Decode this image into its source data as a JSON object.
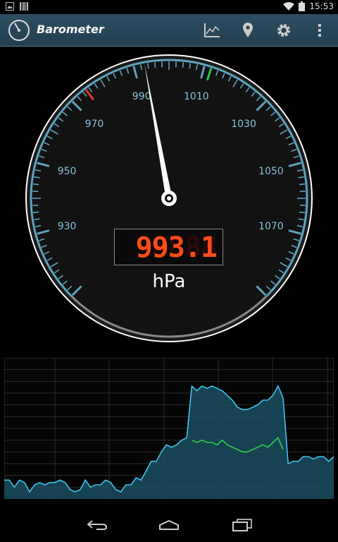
{
  "status_bar": {
    "time": "15:53"
  },
  "action_bar": {
    "title": "Barometer",
    "icons": [
      "gauge-logo-icon",
      "chart-icon",
      "location-pin-icon",
      "gear-icon",
      "overflow-menu-icon"
    ]
  },
  "gauge": {
    "min": 910,
    "max": 1090,
    "reading": 993.1,
    "low_marker": 975,
    "high_marker": 1012,
    "tick_labels": [
      "930",
      "950",
      "970",
      "990",
      "1010",
      "1030",
      "1050",
      "1070"
    ],
    "display_value": "993.1",
    "display_ghost": "8888",
    "unit": "hPa",
    "colors": {
      "ring": "#5fa2bd",
      "needle": "#ffffff",
      "low": "#e23a2a",
      "high": "#2fc84a",
      "lcd": "#ff4a1c"
    }
  },
  "chart_data": {
    "type": "line",
    "grid": true,
    "series": [
      {
        "values": [
          8,
          8,
          5,
          8,
          7,
          3,
          6,
          7,
          6,
          7,
          7,
          8,
          7,
          4,
          3,
          4,
          8,
          5,
          6,
          6,
          8,
          7,
          4,
          3,
          6,
          6,
          9,
          8,
          12,
          16,
          16,
          20,
          23,
          22,
          23,
          25,
          26,
          48,
          46,
          48,
          47,
          48,
          47,
          46,
          44,
          42,
          39,
          38,
          38,
          39,
          40,
          42,
          42,
          44,
          48,
          43,
          15,
          16,
          16,
          18,
          18,
          17,
          18,
          18,
          16,
          18
        ]
      },
      {
        "values": [
          null,
          null,
          null,
          null,
          null,
          null,
          null,
          null,
          null,
          null,
          null,
          null,
          null,
          null,
          null,
          null,
          null,
          null,
          null,
          null,
          null,
          null,
          null,
          null,
          null,
          null,
          null,
          null,
          null,
          null,
          null,
          null,
          null,
          null,
          null,
          null,
          null,
          25,
          24,
          25,
          24,
          24,
          23,
          25,
          23,
          22,
          21,
          20,
          20,
          21,
          22,
          23,
          22,
          24,
          26,
          21,
          null,
          null,
          null,
          null,
          null,
          null,
          null,
          null,
          null,
          null
        ]
      }
    ],
    "ylim": [
      0,
      60
    ],
    "colors": [
      "#3ec4ec",
      "#2fd14a"
    ]
  },
  "nav_bar": {
    "icons": [
      "back-icon",
      "home-icon",
      "recents-icon"
    ]
  }
}
